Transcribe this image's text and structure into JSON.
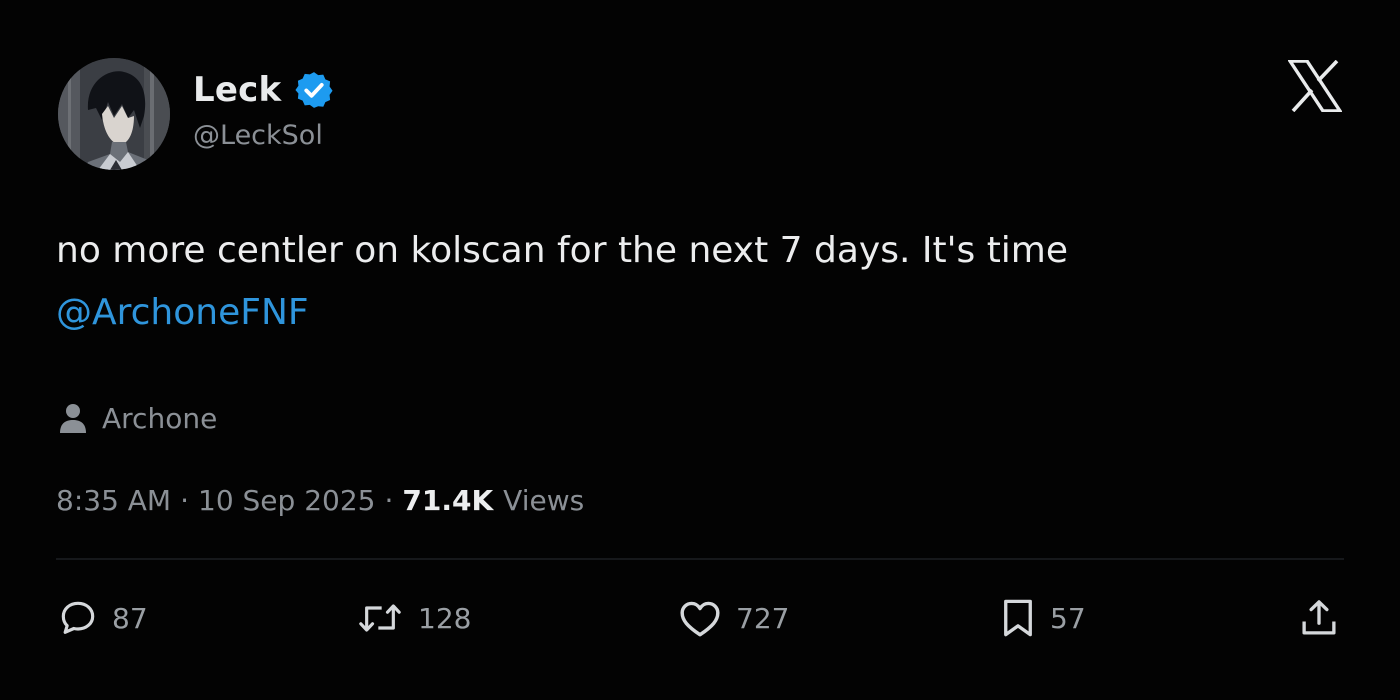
{
  "author": {
    "display_name": "Leck",
    "handle": "@LeckSol",
    "verified": true,
    "verified_color": "#1d9bf0"
  },
  "tweet": {
    "text": "no more centler on kolscan for the next 7 days. It's time",
    "mention": "@ArchoneFNF",
    "mention_color": "#2f95dc"
  },
  "tagged": {
    "icon": "person-icon",
    "name": "Archone"
  },
  "meta": {
    "time": "8:35 AM",
    "separator": "·",
    "date": "10 Sep 2025",
    "views_count": "71.4K",
    "views_label": "Views"
  },
  "actions": {
    "reply": {
      "icon": "reply-icon",
      "count": "87"
    },
    "retweet": {
      "icon": "retweet-icon",
      "count": "128"
    },
    "like": {
      "icon": "heart-icon",
      "count": "727"
    },
    "bookmark": {
      "icon": "bookmark-icon",
      "count": "57"
    },
    "share": {
      "icon": "share-icon"
    }
  },
  "brand": {
    "logo": "x-logo-icon"
  },
  "colors": {
    "background": "#030303",
    "text_primary": "#ecedee",
    "text_secondary": "#8b9096",
    "accent": "#2f95dc"
  }
}
